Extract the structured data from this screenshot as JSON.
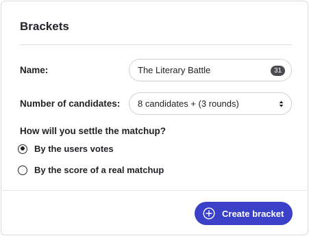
{
  "panel": {
    "title": "Brackets"
  },
  "form": {
    "name_label": "Name:",
    "name_value": "The Literary Battle",
    "name_counter": "31",
    "count_label": "Number of candidates:",
    "count_selected": "8 candidates + (3 rounds)",
    "settle_question": "How will you settle the matchup?",
    "settle_options": [
      {
        "label": "By the users votes",
        "checked": true
      },
      {
        "label": "By the score of a real matchup",
        "checked": false
      }
    ]
  },
  "footer": {
    "create_label": "Create bracket"
  },
  "colors": {
    "accent": "#3a41c8",
    "badge": "#4a4a50"
  },
  "icons": {
    "create": "plus-circle-icon",
    "select": "updown-arrows-icon"
  }
}
